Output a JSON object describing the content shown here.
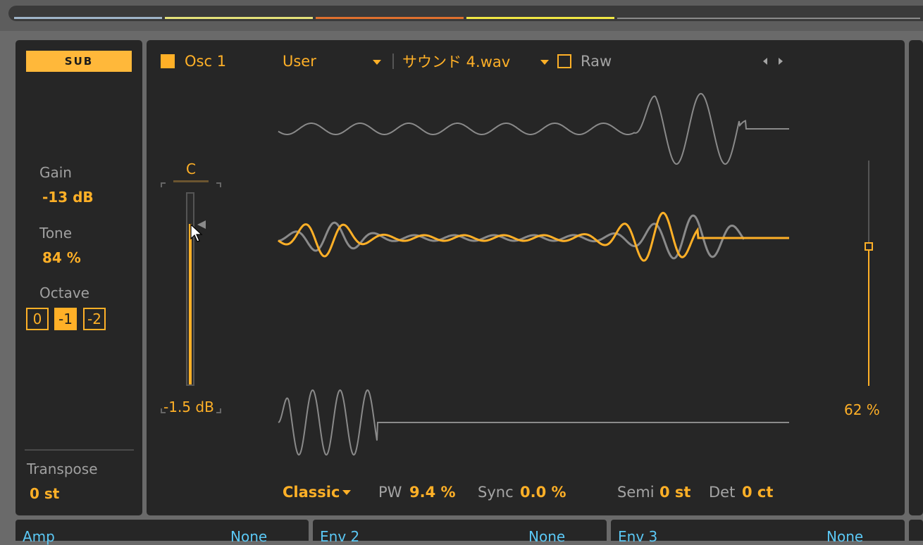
{
  "sub": {
    "label": "SUB",
    "gain_label": "Gain",
    "gain_value": "-13 dB",
    "tone_label": "Tone",
    "tone_value": "84 %",
    "octave_label": "Octave",
    "octave_options": [
      "0",
      "-1",
      "-2"
    ],
    "octave_selected": "-1",
    "transpose_label": "Transpose",
    "transpose_value": "0 st"
  },
  "osc": {
    "title": "Osc 1",
    "category": "User",
    "wavetable": "サウンド 4.wav",
    "raw_label": "Raw",
    "raw_checked": false,
    "level_note": "C",
    "level_value": "-1.5 dB",
    "level_fraction": 0.84,
    "position_value": "62 %",
    "position_fraction": 0.62
  },
  "footer": {
    "mode": "Classic",
    "pw_label": "PW",
    "pw_value": "9.4 %",
    "sync_label": "Sync",
    "sync_value": "0.0 %",
    "semi_label": "Semi",
    "semi_value": "0 st",
    "det_label": "Det",
    "det_value": "0 ct"
  },
  "bottom_tabs": [
    {
      "name": "Amp",
      "value": "None"
    },
    {
      "name": "Env 2",
      "value": "None"
    },
    {
      "name": "Env 3",
      "value": "None"
    }
  ],
  "colors": {
    "accent": "#ffb027",
    "panel": "#262626",
    "wave_grey": "#8a8a8a",
    "tab_blue": "#5bc8f5"
  }
}
